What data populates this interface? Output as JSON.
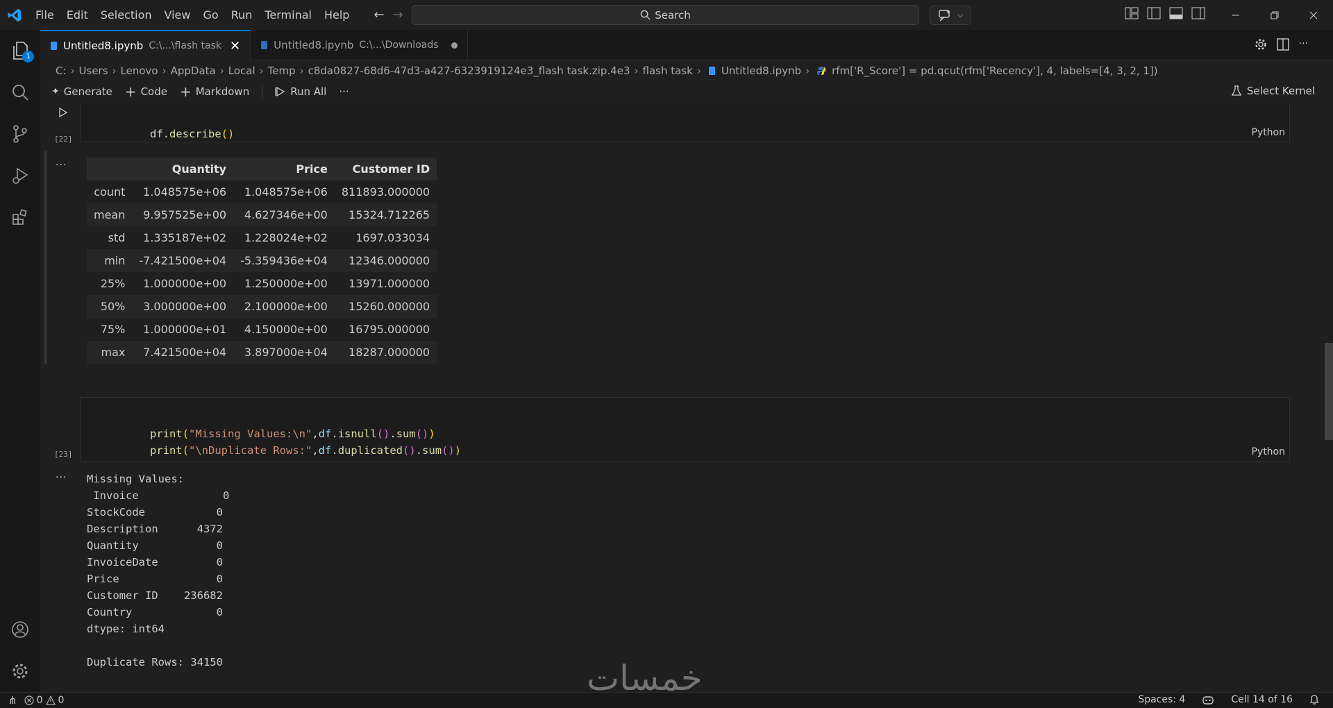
{
  "titlebar": {
    "menu": [
      "File",
      "Edit",
      "Selection",
      "View",
      "Go",
      "Run",
      "Terminal",
      "Help"
    ],
    "search_placeholder": "Search"
  },
  "activitybar": {
    "explorer_badge": "1"
  },
  "tabs": [
    {
      "label": "Untitled8.ipynb",
      "path": "C:\\...\\flash task",
      "active": true
    },
    {
      "label": "Untitled8.ipynb",
      "path": "C:\\...\\Downloads",
      "active": false
    }
  ],
  "breadcrumb": [
    "C:",
    "Users",
    "Lenovo",
    "AppData",
    "Local",
    "Temp",
    "c8da0827-68d6-47d3-a427-6323919124e3_flash task.zip.4e3",
    "flash task",
    "Untitled8.ipynb",
    "rfm['R_Score'] = pd.qcut(rfm['Recency'], 4, labels=[4, 3, 2, 1])"
  ],
  "toolbar": {
    "generate": "Generate",
    "code": "Code",
    "markdown": "Markdown",
    "run_all": "Run All",
    "more": "···",
    "select_kernel": "Select Kernel"
  },
  "cells": {
    "cell22": {
      "exec": "[22]",
      "lang": "Python",
      "code": "df.describe()",
      "out_dots": "···",
      "table": {
        "columns": [
          "",
          "Quantity",
          "Price",
          "Customer ID"
        ],
        "rows": [
          [
            "count",
            "1.048575e+06",
            "1.048575e+06",
            "811893.000000"
          ],
          [
            "mean",
            "9.957525e+00",
            "4.627346e+00",
            "15324.712265"
          ],
          [
            "std",
            "1.335187e+02",
            "1.228024e+02",
            "1697.033034"
          ],
          [
            "min",
            "-7.421500e+04",
            "-5.359436e+04",
            "12346.000000"
          ],
          [
            "25%",
            "1.000000e+00",
            "1.250000e+00",
            "13971.000000"
          ],
          [
            "50%",
            "3.000000e+00",
            "2.100000e+00",
            "15260.000000"
          ],
          [
            "75%",
            "1.000000e+01",
            "4.150000e+00",
            "16795.000000"
          ],
          [
            "max",
            "7.421500e+04",
            "3.897000e+04",
            "18287.000000"
          ]
        ]
      }
    },
    "cell23": {
      "exec": "[23]",
      "lang": "Python",
      "line1": {
        "fn": "print",
        "str": "\"Missing Values:\\n\"",
        "obj": "df",
        "m1": "isnull",
        "m2": "sum"
      },
      "line2": {
        "fn": "print",
        "str": "\"\\nDuplicate Rows:\"",
        "obj": "df",
        "m1": "duplicated",
        "m2": "sum"
      },
      "out_dots": "···",
      "output": "Missing Values:\n Invoice             0\nStockCode           0\nDescription      4372\nQuantity            0\nInvoiceDate         0\nPrice               0\nCustomer ID    236682\nCountry             0\ndtype: int64\n\nDuplicate Rows: 34150"
    }
  },
  "statusbar": {
    "errors": "0",
    "warnings": "0",
    "spaces": "Spaces: 4",
    "cell": "Cell 14 of 16"
  },
  "colors": {
    "accent": "#0078d4",
    "background": "#1f1f1f"
  }
}
